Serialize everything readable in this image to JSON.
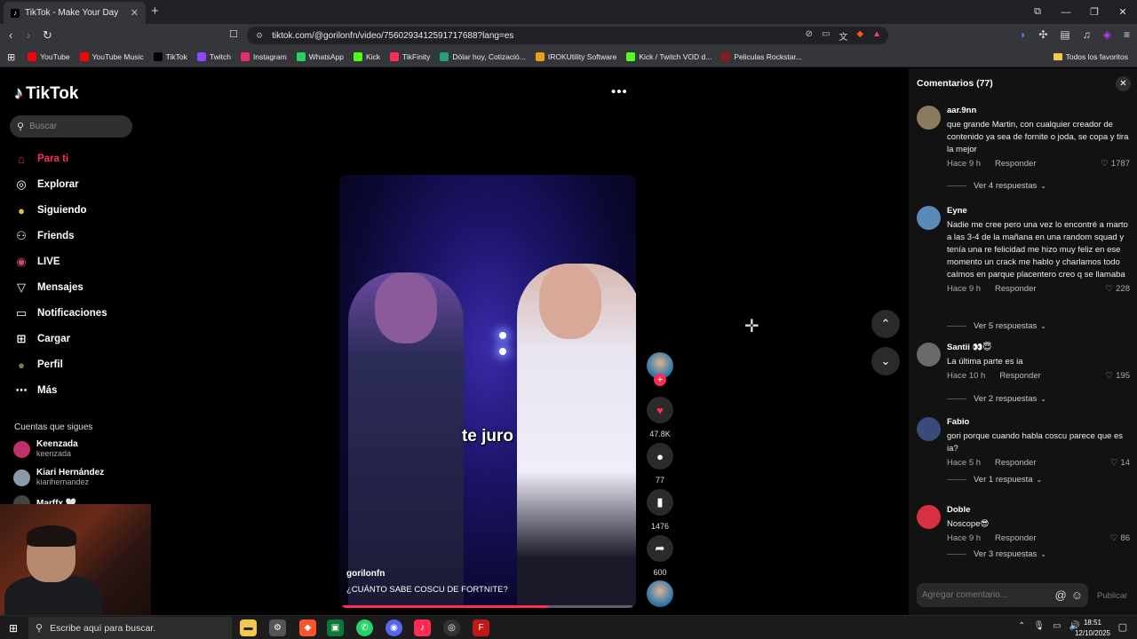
{
  "browser": {
    "tab_title": "TikTok - Make Your Day",
    "url": "tiktok.com/@gorilonfn/video/7560293412591717688?lang=es",
    "bookmarks": [
      {
        "label": "YouTube",
        "color": "#ff0000"
      },
      {
        "label": "YouTube Music",
        "color": "#ff0000"
      },
      {
        "label": "TikTok",
        "color": "#000000"
      },
      {
        "label": "Twitch",
        "color": "#9146ff"
      },
      {
        "label": "Instagram",
        "color": "#e1306c"
      },
      {
        "label": "WhatsApp",
        "color": "#25d366"
      },
      {
        "label": "Kick",
        "color": "#53fc18"
      },
      {
        "label": "TikFinity",
        "color": "#fe2c55"
      },
      {
        "label": "Dólar hoy, Cotizació...",
        "color": "#1fa37a"
      },
      {
        "label": "IROKUtility Software",
        "color": "#f0a020"
      },
      {
        "label": "Kick / Twitch VOD d...",
        "color": "#53fc18"
      },
      {
        "label": "Peliculas Rockstar...",
        "color": "#8a1a1a"
      }
    ],
    "all_bookmarks": "Todos los favoritos"
  },
  "sidebar": {
    "logo": "TikTok",
    "search_placeholder": "Buscar",
    "items": [
      {
        "label": "Para ti",
        "icon": "home-icon",
        "active": true
      },
      {
        "label": "Explorar",
        "icon": "compass-icon"
      },
      {
        "label": "Siguiendo",
        "icon": "following-avatar-icon"
      },
      {
        "label": "Friends",
        "icon": "friends-icon"
      },
      {
        "label": "LIVE",
        "icon": "live-icon"
      },
      {
        "label": "Mensajes",
        "icon": "messages-icon"
      },
      {
        "label": "Notificaciones",
        "icon": "notifications-icon"
      },
      {
        "label": "Cargar",
        "icon": "upload-icon"
      },
      {
        "label": "Perfil",
        "icon": "profile-icon"
      },
      {
        "label": "Más",
        "icon": "more-icon"
      }
    ],
    "following_title": "Cuentas que sigues",
    "following": [
      {
        "name": "Keenzada",
        "handle": "keenzada"
      },
      {
        "name": "Kiari Hernández",
        "handle": "kiarihernandez"
      },
      {
        "name": "Marffx 🤍",
        "handle": ""
      }
    ]
  },
  "video": {
    "caption": "te juro",
    "author": "gorilonfn",
    "description": "¿CUÁNTO SABE COSCU DE FORTNITE?",
    "progress": 0.71,
    "likes": "47.8K",
    "comments": "77",
    "saves": "1476",
    "shares": "600"
  },
  "comments": {
    "title": "Comentarios (77)",
    "reply_label": "Responder",
    "input_placeholder": "Agregar comentario...",
    "publish_label": "Publicar",
    "items": [
      {
        "user": "aar.9nn",
        "text": "que grande Martin, con cualquier creador de contenido ya sea de fornite o joda, se copa y tira la mejor",
        "time": "Hace 9 h",
        "likes": "1787",
        "replies": "Ver 4 respuestas",
        "avatar_color": "#8a7a60"
      },
      {
        "user": "Eyne",
        "text": "Nadie me cree pero una vez lo encontré a marto a las 3-4 de la mañana en una random squad y tenía una re felicidad me hizo muy feliz en ese momento un crack me hablo y charlamos todo caímos en parque placentero creo q se llamaba",
        "time": "Hace 9 h",
        "likes": "228",
        "replies": "Ver 5 respuestas",
        "avatar_color": "#5a8ab8"
      },
      {
        "user": "Santii 👀😇",
        "text": "La última parte es ia",
        "time": "Hace 10 h",
        "likes": "195",
        "replies": "Ver 2 respuestas",
        "avatar_color": "#6a6a6a"
      },
      {
        "user": "Fabio",
        "text": "gori porque cuando habla coscu parece que es ia?",
        "time": "Hace 5 h",
        "likes": "14",
        "replies": "Ver 1 respuesta",
        "avatar_color": "#3a4a7a"
      },
      {
        "user": "Doble",
        "text": "Noscope😎",
        "time": "Hace 9 h",
        "likes": "86",
        "replies": "Ver 3 respuestas",
        "avatar_color": "#d83040"
      }
    ]
  },
  "taskbar": {
    "search_placeholder": "Escribe aquí para buscar.",
    "time": "18:51",
    "date": "12/10/2025"
  }
}
